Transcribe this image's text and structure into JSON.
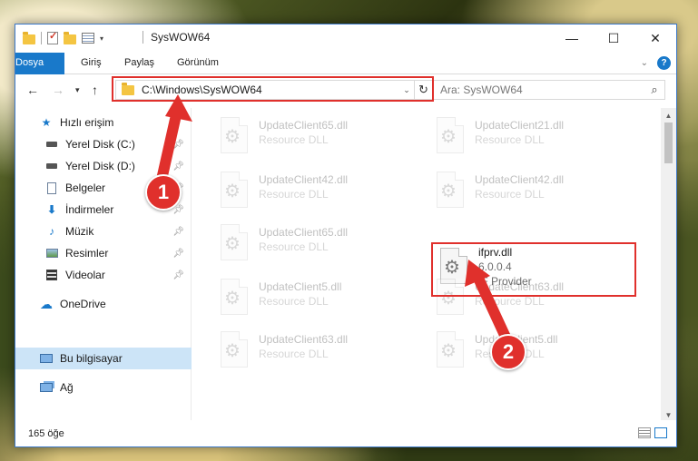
{
  "window": {
    "title": "SysWOW64",
    "controls": {
      "minimize": "—",
      "maximize": "☐",
      "close": "✕"
    }
  },
  "ribbon": {
    "tabs": [
      "Dosya",
      "Giriş",
      "Paylaş",
      "Görünüm"
    ]
  },
  "nav": {
    "address": "C:\\Windows\\SysWOW64",
    "search_placeholder": "Ara: SysWOW64"
  },
  "sidebar": {
    "items": [
      {
        "label": "Hızlı erişim",
        "icon": "star-icon"
      },
      {
        "label": "Yerel Disk (C:)",
        "icon": "drive-icon",
        "pinned": true
      },
      {
        "label": "Yerel Disk (D:)",
        "icon": "drive-icon",
        "pinned": true
      },
      {
        "label": "Belgeler",
        "icon": "documents-icon",
        "pinned": true
      },
      {
        "label": "İndirmeler",
        "icon": "download-icon",
        "pinned": true
      },
      {
        "label": "Müzik",
        "icon": "music-icon",
        "pinned": true
      },
      {
        "label": "Resimler",
        "icon": "pictures-icon",
        "pinned": true
      },
      {
        "label": "Videolar",
        "icon": "videos-icon",
        "pinned": true
      },
      {
        "label": "OneDrive",
        "icon": "cloud-icon"
      },
      {
        "label": "Bu bilgisayar",
        "icon": "computer-icon",
        "selected": true
      },
      {
        "label": "Ağ",
        "icon": "network-icon"
      }
    ]
  },
  "files": [
    {
      "name": "UpdateClient65.dll",
      "sub": "Resource DLL",
      "ghost": true
    },
    {
      "name": "UpdateClient21.dll",
      "sub": "Resource DLL",
      "ghost": true
    },
    {
      "name": "UpdateClient42.dll",
      "sub": "Resource DLL",
      "ghost": true
    },
    {
      "name": "UpdateClient42.dll",
      "sub": "Resource DLL",
      "ghost": true
    },
    {
      "name": "UpdateClient65.dll",
      "sub": "Resource DLL",
      "ghost": true
    },
    {
      "name": "ifprv.dll",
      "sub": "6.0.0.4",
      "sub2": "IF Provider",
      "ghost": false
    },
    {
      "name": "UpdateClient5.dll",
      "sub": "Resource DLL",
      "ghost": true
    },
    {
      "name": "UpdateClient63.dll",
      "sub": "Resource DLL",
      "ghost": true
    },
    {
      "name": "UpdateClient63.dll",
      "sub": "Resource DLL",
      "ghost": true
    },
    {
      "name": "UpdateClient5.dll",
      "sub": "Resource DLL",
      "ghost": true
    }
  ],
  "status": {
    "count_text": "165 öğe"
  },
  "callouts": [
    "1",
    "2"
  ],
  "colors": {
    "accent": "#1979ca",
    "highlight": "#e0302c",
    "selected": "#cce4f7"
  }
}
